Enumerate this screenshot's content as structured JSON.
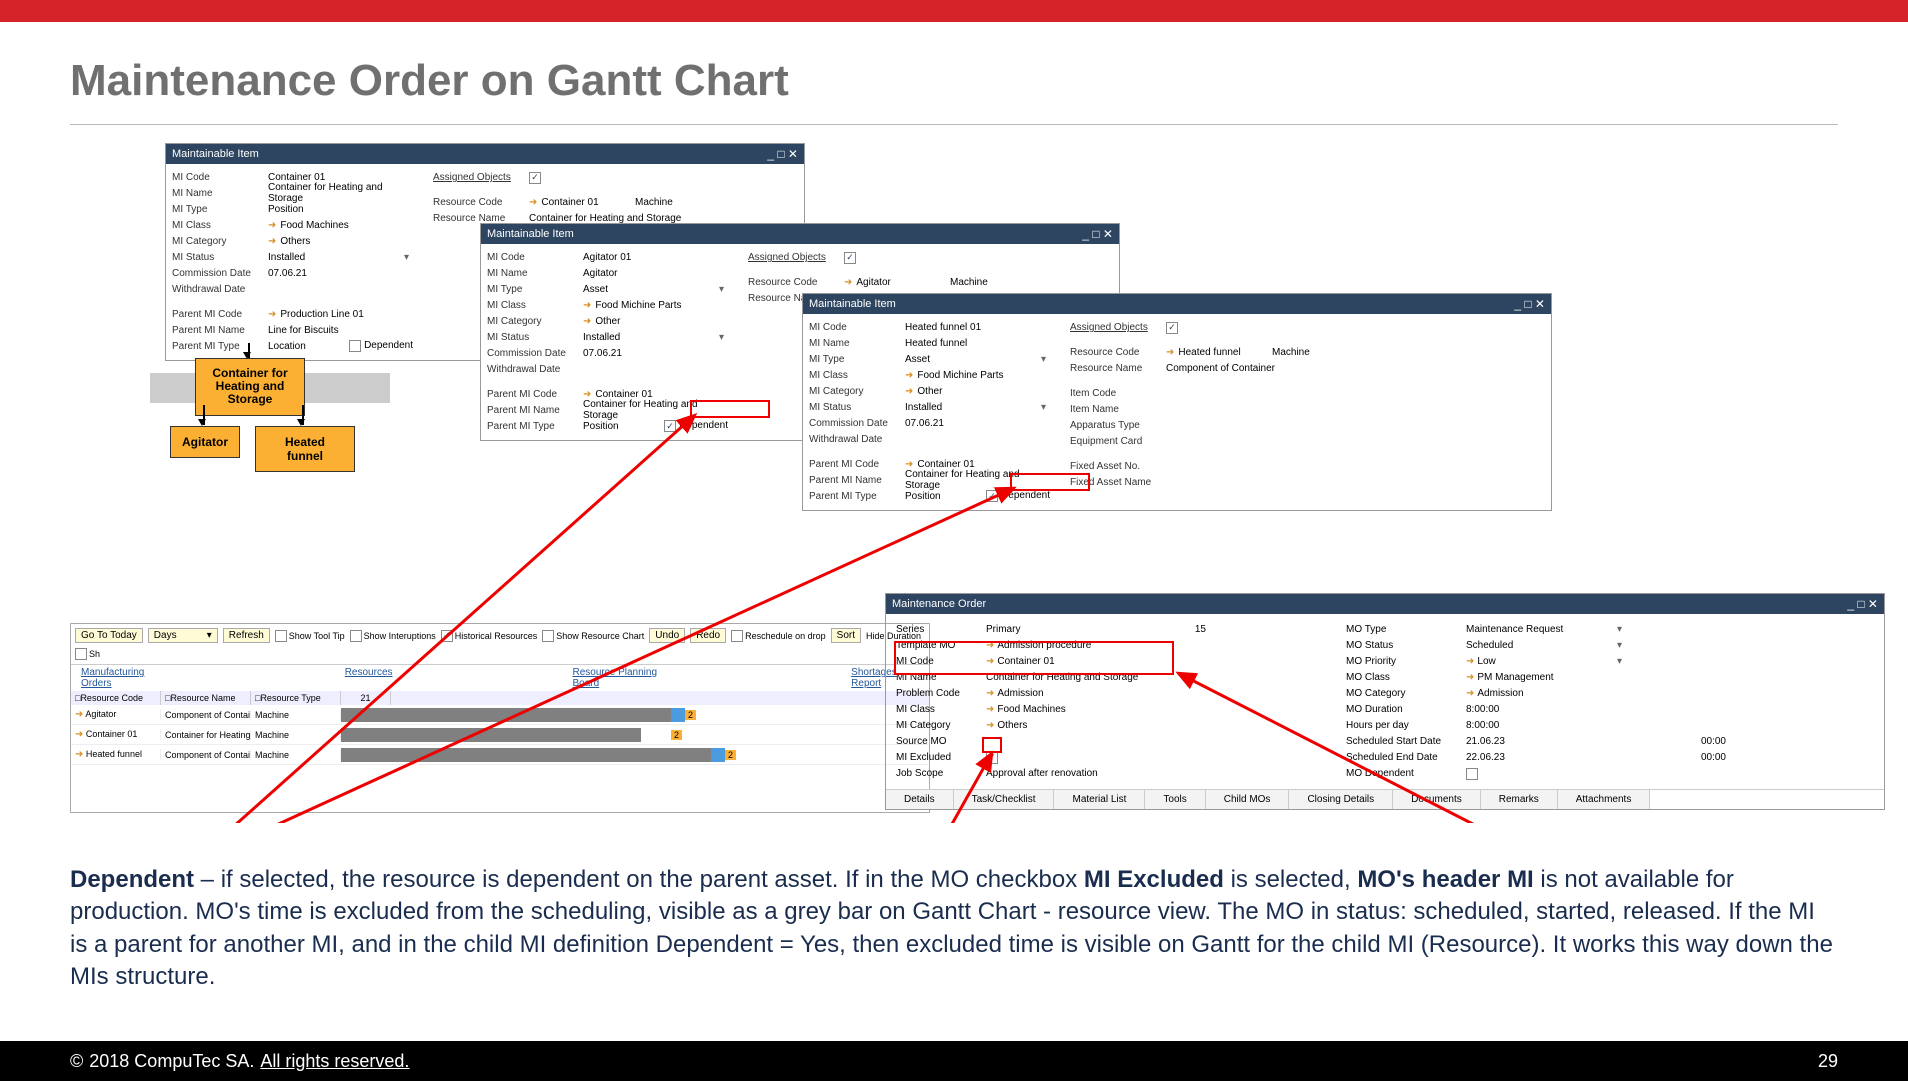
{
  "slide": {
    "title": "Maintenance Order on Gantt Chart",
    "page": "29"
  },
  "footer": {
    "c": "©",
    "y": "2018 CompuTec SA.",
    "r": "All rights reserved."
  },
  "desc": {
    "t1": "Dependent",
    "t2": " – if selected, the resource is dependent on the parent asset. If in the MO checkbox ",
    "t3": "MI Excluded",
    "t4": " is selected, ",
    "t5": "MO's header MI",
    "t6": " is not available for production. MO's time is excluded from the scheduling, visible as a grey bar on Gantt Chart - resource view.  The MO in status: scheduled, started, released. If the MI is a parent for another MI, and in the child MI definition Dependent = Yes, then excluded time is visible on Gantt for the child MI (Resource). It works this way down the MIs structure."
  },
  "labels": {
    "mi": "Maintainable Item",
    "mi_code": "MI Code",
    "mi_name": "MI Name",
    "mi_type": "MI Type",
    "mi_class": "MI Class",
    "mi_cat": "MI Category",
    "mi_status": "MI Status",
    "comm": "Commission Date",
    "with": "Withdrawal Date",
    "p_code": "Parent MI Code",
    "p_name": "Parent MI Name",
    "p_type": "Parent MI Type",
    "ao": "Assigned Objects",
    "rc": "Resource Code",
    "rn": "Resource Name",
    "mach": "Machine",
    "pos": "Position",
    "loc": "Location",
    "dep": "Dependent",
    "asset": "Asset",
    "inst": "Installed",
    "item_code": "Item Code",
    "item_name": "Item Name",
    "app": "Apparatus Type",
    "eq": "Equipment Card",
    "fa_no": "Fixed Asset No.",
    "fa_name": "Fixed Asset Name"
  },
  "w1": {
    "code": "Container 01",
    "name": "Container for Heating and Storage",
    "class": "Food Machines",
    "cat": "Others",
    "date": "07.06.21",
    "p_code": "Production Line 01",
    "p_name": "Line for Biscuits",
    "rc": "Container 01",
    "rn": "Container for Heating and Storage"
  },
  "w2": {
    "code": "Agitator 01",
    "name": "Agitator",
    "class": "Food Michine Parts",
    "cat": "Other",
    "date": "07.06.21",
    "p_code": "Container 01",
    "p_name": "Container for Heating and Storage",
    "rc": "Agitator",
    "rn": "Component of Container"
  },
  "w3": {
    "code": "Heated funnel 01",
    "name": "Heated funnel",
    "class": "Food Michine Parts",
    "cat": "Other",
    "date": "07.06.21",
    "p_code": "Container 01",
    "p_name": "Container for Heating and Storage",
    "rc": "Heated funnel",
    "rn": "Component of Container"
  },
  "hier": {
    "main": "Container for Heating and Storage",
    "c1": "Agitator",
    "c2": "Heated funnel"
  },
  "gantt": {
    "goto": "Go To Today",
    "days": "Days",
    "refresh": "Refresh",
    "tip": "Show Tool Tip",
    "intr": "Show Interuptions",
    "hist": "Historical Resources",
    "src": "Show Resource Chart",
    "undo": "Undo",
    "redo": "Redo",
    "resch": "Reschedule on drop",
    "sort": "Sort",
    "hide": "Hide Duration",
    "sh": "Sh",
    "t1": "Manufacturing Orders",
    "t2": "Resources",
    "t3": "Resource Planning Board",
    "t4": "Shortages Report",
    "h1": "Resource Code",
    "h2": "Resource Name",
    "h3": "Resource Type",
    "rows": [
      {
        "c": "Agitator",
        "n": "Component of Contair",
        "t": "Machine"
      },
      {
        "c": "Container 01",
        "n": "Container for Heating",
        "t": "Machine"
      },
      {
        "c": "Heated funnel",
        "n": "Component of Contair",
        "t": "Machine"
      }
    ],
    "n21": "21",
    "n2": "2"
  },
  "mo": {
    "title": "Maintenance Order",
    "series": "Series",
    "series_v": "Primary",
    "series_n": "15",
    "tmp": "Template MO",
    "tmp_v": "Admission procedure",
    "mic": "MI Code",
    "mic_v": "Container 01",
    "min": "MI Name",
    "min_v": "Container for Heating and Storage",
    "pc": "Problem Code",
    "pc_v": "Admission",
    "cls": "MI Class",
    "cls_v": "Food Machines",
    "cat": "MI Category",
    "cat_v": "Others",
    "src": "Source MO",
    "ex": "MI Excluded",
    "job": "Job Scope",
    "job_v": "Approval after renovation",
    "type": "MO Type",
    "type_v": "Maintenance Request",
    "st": "MO Status",
    "st_v": "Scheduled",
    "pri": "MO Priority",
    "pri_v": "Low",
    "mcls": "MO Class",
    "mcls_v": "PM Management",
    "mcat": "MO Category",
    "mcat_v": "Admission",
    "dur": "MO Duration",
    "dur_v": "8:00:00",
    "hpd": "Hours per day",
    "hpd_v": "8:00:00",
    "ssd": "Scheduled Start Date",
    "ssd_v": "21.06.23",
    "ssd_t": "00:00",
    "sed": "Scheduled End Date",
    "sed_v": "22.06.23",
    "sed_t": "00:00",
    "dep": "MO Dependent",
    "tabs": [
      "Details",
      "Task/Checklist",
      "Material List",
      "Tools",
      "Child MOs",
      "Closing Details",
      "Documents",
      "Remarks",
      "Attachments"
    ]
  }
}
